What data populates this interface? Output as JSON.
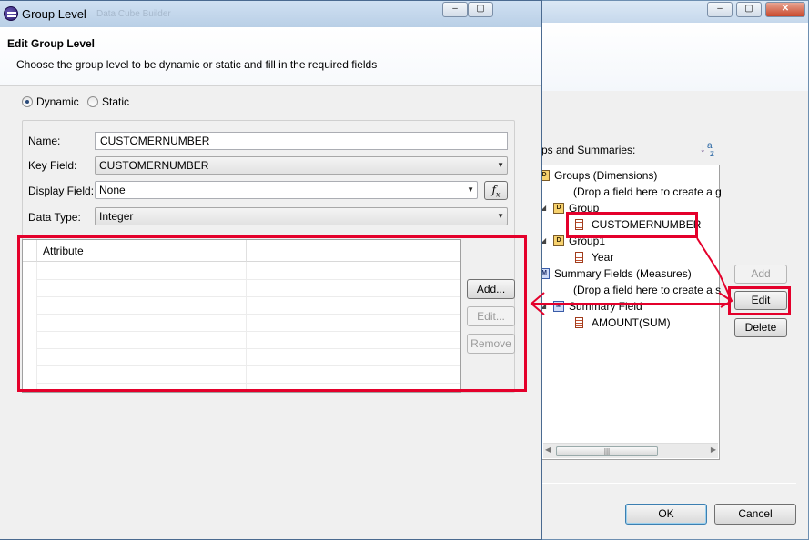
{
  "background_window": {
    "window_buttons": [
      "–",
      "▢",
      "✕"
    ],
    "tree_label": "ps and Summaries:",
    "tree": [
      {
        "text": "Groups (Dimensions)",
        "kind": "folder",
        "level": 0
      },
      {
        "text": "(Drop a field here to create a g",
        "kind": "none",
        "level": 1
      },
      {
        "text": "Group",
        "kind": "dim",
        "level": 1
      },
      {
        "text": "CUSTOMERNUMBER",
        "kind": "field",
        "level": 2
      },
      {
        "text": "Group1",
        "kind": "dim",
        "level": 1
      },
      {
        "text": "Year",
        "kind": "field",
        "level": 2
      },
      {
        "text": "Summary Fields (Measures)",
        "kind": "measure-folder",
        "level": 0
      },
      {
        "text": "(Drop a field here to create a s",
        "kind": "none",
        "level": 1
      },
      {
        "text": "Summary Field",
        "kind": "measure",
        "level": 1
      },
      {
        "text": "AMOUNT(SUM)",
        "kind": "field",
        "level": 2
      }
    ],
    "buttons": {
      "add": "Add",
      "edit": "Edit",
      "delete": "Delete",
      "ok": "OK",
      "cancel": "Cancel"
    }
  },
  "dialog": {
    "title": "Group Level",
    "title_ghost": "Data Cube Builder",
    "window_buttons": [
      "–",
      "▢"
    ],
    "heading": "Edit Group Level",
    "description": "Choose the group level to be dynamic or static and fill in the required fields",
    "radio": {
      "dynamic": "Dynamic",
      "static": "Static",
      "selected": "dynamic"
    },
    "fields": {
      "name_label": "Name:",
      "name_value": "CUSTOMERNUMBER",
      "key_field_label": "Key Field:",
      "key_field_value": "CUSTOMERNUMBER",
      "display_field_label": "Display Field:",
      "display_field_value": "None",
      "data_type_label": "Data Type:",
      "data_type_value": "Integer",
      "fx_label": "f"
    },
    "table": {
      "columns": [
        "",
        "Attribute",
        ""
      ],
      "rows": []
    },
    "buttons": {
      "add": "Add...",
      "edit": "Edit...",
      "remove": "Remove"
    }
  },
  "icons": [
    "sort-az-icon",
    "dimension-folder-icon",
    "field-icon",
    "measure-icon",
    "radio-icon",
    "dropdown-arrow-icon",
    "expression-fx-icon",
    "app-logo-icon"
  ],
  "accent_colors": {
    "annotation_red": "#e4002b",
    "titlebar": "#c6d8ec"
  }
}
